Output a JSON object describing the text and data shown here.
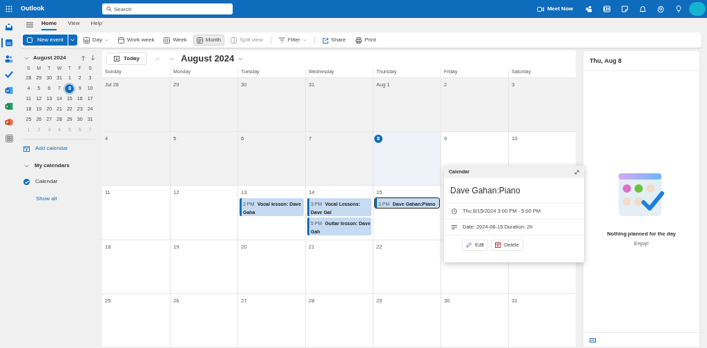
{
  "app": {
    "name": "Outlook"
  },
  "search": {
    "placeholder": "Search"
  },
  "meet_now": "Meet Now",
  "rail": [
    {
      "kind": "mail",
      "selected": false
    },
    {
      "kind": "calendar",
      "selected": true
    },
    {
      "kind": "people",
      "selected": false
    },
    {
      "kind": "todo",
      "selected": false
    },
    {
      "kind": "word",
      "selected": false
    },
    {
      "kind": "excel",
      "selected": false
    },
    {
      "kind": "powerpoint",
      "selected": false
    },
    {
      "kind": "apps",
      "selected": false
    }
  ],
  "ribbon_tabs": [
    {
      "label": "Home",
      "selected": true
    },
    {
      "label": "View",
      "selected": false
    },
    {
      "label": "Help",
      "selected": false
    }
  ],
  "toolbar": [
    {
      "kind": "primary",
      "label": "New event"
    },
    {
      "kind": "view",
      "label": "Day",
      "caret": true,
      "selected": false,
      "disabled": false
    },
    {
      "kind": "view",
      "label": "Work week",
      "caret": false,
      "selected": false,
      "disabled": false
    },
    {
      "kind": "view",
      "label": "Week",
      "caret": false,
      "selected": false,
      "disabled": false
    },
    {
      "kind": "view",
      "label": "Month",
      "caret": false,
      "selected": true,
      "disabled": false
    },
    {
      "kind": "view",
      "label": "Split view",
      "caret": false,
      "selected": false,
      "disabled": true
    },
    {
      "kind": "view",
      "label": "Filter",
      "caret": true,
      "selected": false,
      "disabled": false
    },
    {
      "kind": "view",
      "label": "Share",
      "caret": false,
      "selected": false,
      "disabled": false
    },
    {
      "kind": "view",
      "label": "Print",
      "caret": false,
      "selected": false,
      "disabled": false
    }
  ],
  "mini_calendar": {
    "title": "August 2024",
    "weekdays": [
      "S",
      "M",
      "T",
      "W",
      "T",
      "F",
      "S"
    ],
    "weeks": [
      [
        {
          "day": "28",
          "muted": false,
          "selected": false
        },
        {
          "day": "29",
          "muted": false,
          "selected": false
        },
        {
          "day": "30",
          "muted": false,
          "selected": false
        },
        {
          "day": "31",
          "muted": false,
          "selected": false
        },
        {
          "day": "1",
          "muted": false,
          "selected": false
        },
        {
          "day": "2",
          "muted": false,
          "selected": false
        },
        {
          "day": "3",
          "muted": false,
          "selected": false
        }
      ],
      [
        {
          "day": "4",
          "muted": false,
          "selected": false
        },
        {
          "day": "5",
          "muted": false,
          "selected": false
        },
        {
          "day": "6",
          "muted": false,
          "selected": false
        },
        {
          "day": "7",
          "muted": false,
          "selected": false
        },
        {
          "day": "8",
          "muted": false,
          "selected": true
        },
        {
          "day": "9",
          "muted": false,
          "selected": false
        },
        {
          "day": "10",
          "muted": false,
          "selected": false
        }
      ],
      [
        {
          "day": "11",
          "muted": false,
          "selected": false
        },
        {
          "day": "12",
          "muted": false,
          "selected": false
        },
        {
          "day": "13",
          "muted": false,
          "selected": false
        },
        {
          "day": "14",
          "muted": false,
          "selected": false
        },
        {
          "day": "15",
          "muted": false,
          "selected": false
        },
        {
          "day": "16",
          "muted": false,
          "selected": false
        },
        {
          "day": "17",
          "muted": false,
          "selected": false
        }
      ],
      [
        {
          "day": "18",
          "muted": false,
          "selected": false
        },
        {
          "day": "19",
          "muted": false,
          "selected": false
        },
        {
          "day": "20",
          "muted": false,
          "selected": false
        },
        {
          "day": "21",
          "muted": false,
          "selected": false
        },
        {
          "day": "22",
          "muted": false,
          "selected": false
        },
        {
          "day": "23",
          "muted": false,
          "selected": false
        },
        {
          "day": "24",
          "muted": false,
          "selected": false
        }
      ],
      [
        {
          "day": "25",
          "muted": false,
          "selected": false
        },
        {
          "day": "26",
          "muted": false,
          "selected": false
        },
        {
          "day": "27",
          "muted": false,
          "selected": false
        },
        {
          "day": "28",
          "muted": false,
          "selected": false
        },
        {
          "day": "29",
          "muted": false,
          "selected": false
        },
        {
          "day": "30",
          "muted": false,
          "selected": false
        },
        {
          "day": "31",
          "muted": false,
          "selected": false
        }
      ],
      [
        {
          "day": "1",
          "muted": true,
          "selected": false
        },
        {
          "day": "2",
          "muted": true,
          "selected": false
        },
        {
          "day": "3",
          "muted": true,
          "selected": false
        },
        {
          "day": "4",
          "muted": true,
          "selected": false
        },
        {
          "day": "5",
          "muted": true,
          "selected": false
        },
        {
          "day": "6",
          "muted": true,
          "selected": false
        },
        {
          "day": "7",
          "muted": true,
          "selected": false
        }
      ]
    ]
  },
  "add_calendar": "Add calendar",
  "my_calendars": {
    "label": "My calendars",
    "items": [
      {
        "name": "Calendar",
        "checked": true
      }
    ]
  },
  "show_all": "Show all",
  "calendar": {
    "today_button": "Today",
    "title": "August 2024",
    "weekdays": [
      "Sunday",
      "Monday",
      "Tuesday",
      "Wednesday",
      "Thursday",
      "Friday",
      "Saturday"
    ],
    "weeks": [
      [
        {
          "date": "Jul 28",
          "past": true,
          "today": false
        },
        {
          "date": "29",
          "past": true,
          "today": false
        },
        {
          "date": "30",
          "past": true,
          "today": false
        },
        {
          "date": "31",
          "past": true,
          "today": false
        },
        {
          "date": "Aug 1",
          "past": true,
          "today": false
        },
        {
          "date": "2",
          "past": true,
          "today": false
        },
        {
          "date": "3",
          "past": true,
          "today": false
        }
      ],
      [
        {
          "date": "4",
          "past": true,
          "today": false
        },
        {
          "date": "5",
          "past": true,
          "today": false
        },
        {
          "date": "6",
          "past": true,
          "today": false
        },
        {
          "date": "7",
          "past": true,
          "today": false
        },
        {
          "date": "8",
          "past": false,
          "today": true
        },
        {
          "date": "9",
          "past": false,
          "today": false
        },
        {
          "date": "10",
          "past": false,
          "today": false
        }
      ],
      [
        {
          "date": "11",
          "past": false,
          "today": false
        },
        {
          "date": "12",
          "past": false,
          "today": false
        },
        {
          "date": "13",
          "past": false,
          "today": false,
          "events": [
            {
              "time": "2 PM",
              "title": "Vocal lesson: Dave Gaha",
              "selected": false
            }
          ]
        },
        {
          "date": "14",
          "past": false,
          "today": false,
          "events": [
            {
              "time": "3 PM",
              "title": "Vocal Lessons: Dave Gal",
              "selected": false
            },
            {
              "time": "5 PM",
              "title": "Guitar lesson: Dave Gah",
              "selected": false
            }
          ]
        },
        {
          "date": "15",
          "past": false,
          "today": false,
          "events": [
            {
              "time": "3 PM",
              "title": "Dave Gahan:Piano",
              "selected": true
            }
          ]
        },
        {
          "past": false,
          "today": false
        }
      ],
      [
        {
          "date": "18",
          "past": false,
          "today": false
        },
        {
          "date": "19",
          "past": false,
          "today": false
        },
        {
          "date": "20",
          "past": false,
          "today": false
        },
        {
          "date": "21",
          "past": false,
          "today": false
        },
        {
          "date": "22",
          "past": false,
          "today": false
        },
        {
          "past": false,
          "today": false
        },
        {
          "past": false,
          "today": false
        }
      ],
      [
        {
          "date": "25",
          "past": false,
          "today": false
        },
        {
          "date": "26",
          "past": false,
          "today": false
        },
        {
          "date": "27",
          "past": false,
          "today": false
        },
        {
          "date": "28",
          "past": false,
          "today": false
        },
        {
          "date": "29",
          "past": false,
          "today": false
        },
        {
          "date": "30",
          "past": false,
          "today": false
        },
        {
          "date": "31",
          "past": false,
          "today": false
        }
      ]
    ]
  },
  "event_popup": {
    "header": "Calendar",
    "title": "Dave Gahan:Piano",
    "time": "Thu 8/15/2024 3:00 PM - 5:00 PM",
    "notes": "Date: 2024-08-15 Duration: 2h",
    "actions": [
      "Edit",
      "Delete"
    ]
  },
  "agenda": {
    "date": "Thu, Aug 8",
    "empty_title": "Nothing planned for the day",
    "empty_subtitle": "Enjoy!"
  }
}
